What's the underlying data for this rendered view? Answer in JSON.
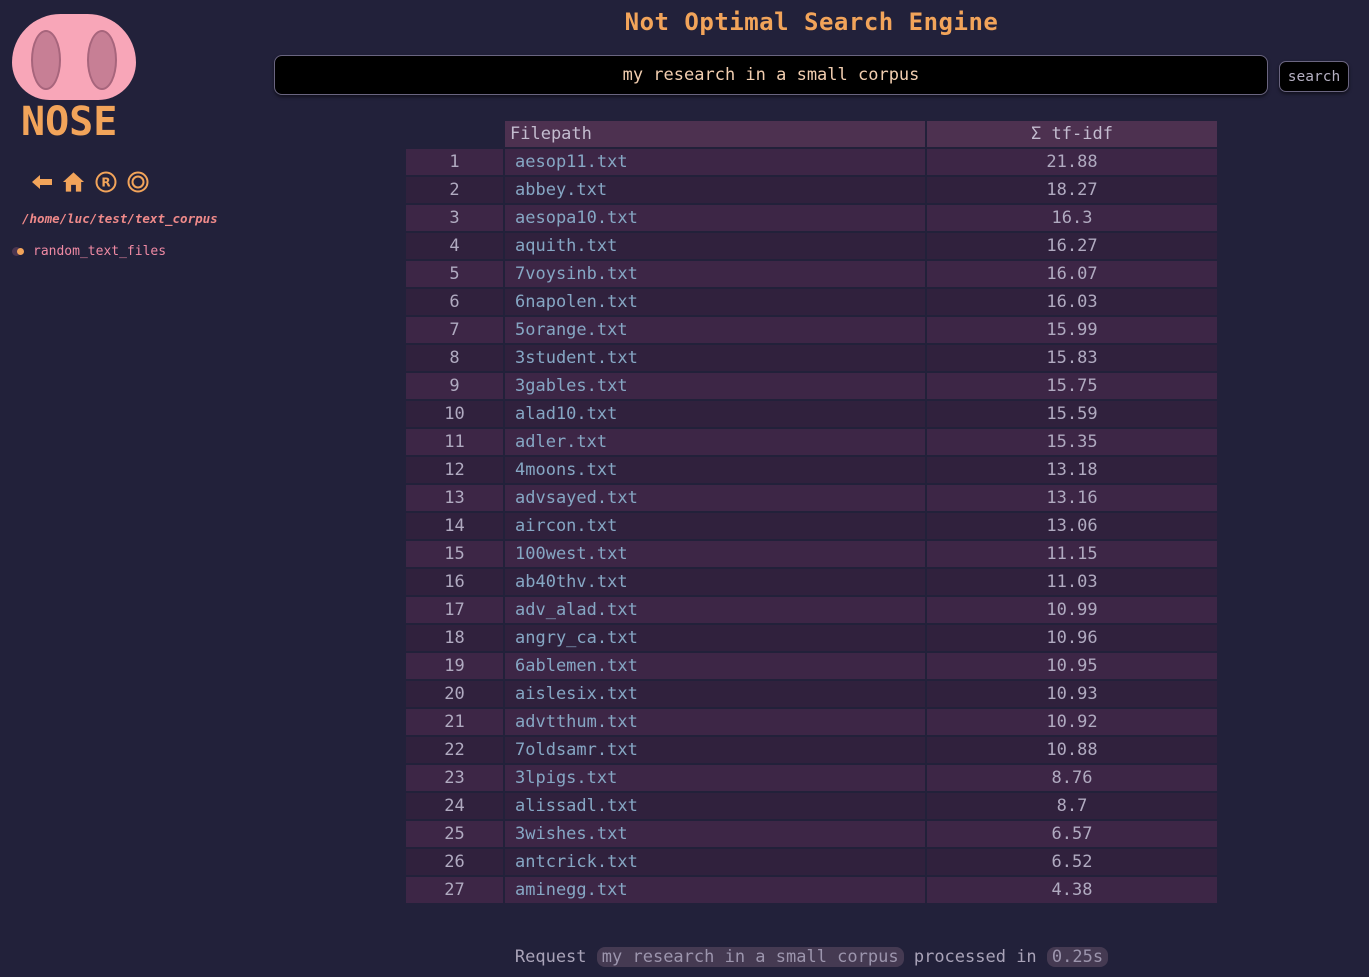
{
  "app": {
    "logo_text": "NOSE",
    "title": "Not Optimal Search Engine"
  },
  "sidebar": {
    "nav_icons": [
      "back-arrow-icon",
      "home-icon",
      "registered-icon",
      "circle-icon"
    ],
    "cwd": "/home/luc/test/text_corpus",
    "directories": [
      {
        "label": "random_text_files"
      }
    ]
  },
  "search": {
    "value": "my research in a small corpus",
    "button_label": "search"
  },
  "results": {
    "headers": {
      "num": "",
      "path": "Filepath",
      "score": "Σ tf-idf"
    },
    "rows": [
      {
        "num": "1",
        "path": "aesop11.txt",
        "score": "21.88"
      },
      {
        "num": "2",
        "path": "abbey.txt",
        "score": "18.27"
      },
      {
        "num": "3",
        "path": "aesopa10.txt",
        "score": "16.3"
      },
      {
        "num": "4",
        "path": "aquith.txt",
        "score": "16.27"
      },
      {
        "num": "5",
        "path": "7voysinb.txt",
        "score": "16.07"
      },
      {
        "num": "6",
        "path": "6napolen.txt",
        "score": "16.03"
      },
      {
        "num": "7",
        "path": "5orange.txt",
        "score": "15.99"
      },
      {
        "num": "8",
        "path": "3student.txt",
        "score": "15.83"
      },
      {
        "num": "9",
        "path": "3gables.txt",
        "score": "15.75"
      },
      {
        "num": "10",
        "path": "alad10.txt",
        "score": "15.59"
      },
      {
        "num": "11",
        "path": "adler.txt",
        "score": "15.35"
      },
      {
        "num": "12",
        "path": "4moons.txt",
        "score": "13.18"
      },
      {
        "num": "13",
        "path": "advsayed.txt",
        "score": "13.16"
      },
      {
        "num": "14",
        "path": "aircon.txt",
        "score": "13.06"
      },
      {
        "num": "15",
        "path": "100west.txt",
        "score": "11.15"
      },
      {
        "num": "16",
        "path": "ab40thv.txt",
        "score": "11.03"
      },
      {
        "num": "17",
        "path": "adv_alad.txt",
        "score": "10.99"
      },
      {
        "num": "18",
        "path": "angry_ca.txt",
        "score": "10.96"
      },
      {
        "num": "19",
        "path": "6ablemen.txt",
        "score": "10.95"
      },
      {
        "num": "20",
        "path": "aislesix.txt",
        "score": "10.93"
      },
      {
        "num": "21",
        "path": "advtthum.txt",
        "score": "10.92"
      },
      {
        "num": "22",
        "path": "7oldsamr.txt",
        "score": "10.88"
      },
      {
        "num": "23",
        "path": "3lpigs.txt",
        "score": "8.76"
      },
      {
        "num": "24",
        "path": "alissadl.txt",
        "score": "8.7"
      },
      {
        "num": "25",
        "path": "3wishes.txt",
        "score": "6.57"
      },
      {
        "num": "26",
        "path": "antcrick.txt",
        "score": "6.52"
      },
      {
        "num": "27",
        "path": "aminegg.txt",
        "score": "4.38"
      }
    ]
  },
  "footer": {
    "prefix": "Request",
    "query": "my research in a small corpus",
    "middle": "processed in",
    "time": "0.25s"
  },
  "colors": {
    "background": "#22213a",
    "accent": "#f2a45a",
    "logo_pink": "#f8a6b8",
    "link": "#86a7c4",
    "row_odd": "#3d2646",
    "row_even": "#30213d",
    "header": "#4d3150"
  }
}
